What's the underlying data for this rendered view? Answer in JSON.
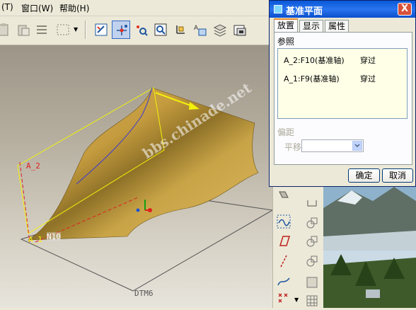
{
  "menubar": {
    "items": [
      {
        "label": "(T)"
      },
      {
        "label": "窗口(W)"
      },
      {
        "label": "帮助(H)"
      }
    ]
  },
  "viewport": {
    "labels": {
      "a2": "A_2",
      "a1": "A_1",
      "n10": "N10",
      "dtm6": "DTM6"
    },
    "watermark": "bbs.chinade.net"
  },
  "dialog": {
    "title": "基准平面",
    "close_label": "X",
    "tabs": [
      {
        "label": "放置",
        "active": true
      },
      {
        "label": "显示",
        "active": false
      },
      {
        "label": "属性",
        "active": false
      }
    ],
    "references_label": "参照",
    "references": [
      {
        "name": "A_2:F10(基准轴)",
        "constraint": "穿过"
      },
      {
        "name": "A_1:F9(基准轴)",
        "constraint": "穿过"
      }
    ],
    "offset_label": "偏距",
    "translate_label": "平移",
    "translate_value": "",
    "ok_label": "确定",
    "cancel_label": "取消"
  },
  "colors": {
    "surface": "#c9a447",
    "datum_frame": "#f2f20a",
    "dialog_title": "#0a58d8"
  }
}
